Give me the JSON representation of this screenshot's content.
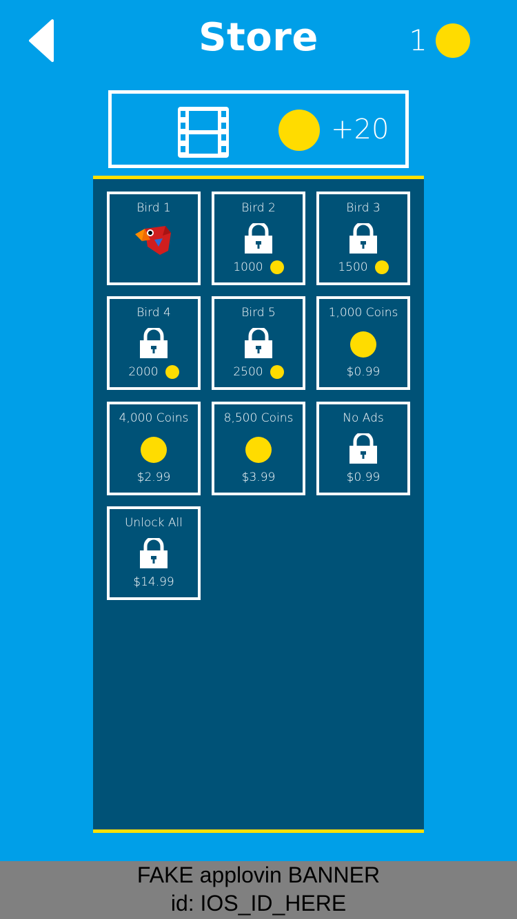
{
  "header": {
    "title": "Store",
    "back_icon": "back-chevron-icon",
    "coin_balance": "1"
  },
  "video_offer": {
    "icon": "film-icon",
    "reward": "+20"
  },
  "store_items": [
    {
      "label": "Bird 1",
      "icon": "bird-icon",
      "state": "owned"
    },
    {
      "label": "Bird 2",
      "icon": "lock-icon",
      "cost": "1000"
    },
    {
      "label": "Bird 3",
      "icon": "lock-icon",
      "cost": "1500"
    },
    {
      "label": "Bird 4",
      "icon": "lock-icon",
      "cost": "2000"
    },
    {
      "label": "Bird 5",
      "icon": "lock-icon",
      "cost": "2500"
    },
    {
      "label": "1,000 Coins",
      "icon": "coin-icon",
      "price": "$0.99"
    },
    {
      "label": "4,000 Coins",
      "icon": "coin-icon",
      "price": "$2.99"
    },
    {
      "label": "8,500 Coins",
      "icon": "coin-icon",
      "price": "$3.99"
    },
    {
      "label": "No Ads",
      "icon": "lock-icon",
      "price": "$0.99"
    },
    {
      "label": "Unlock All",
      "icon": "lock-icon",
      "price": "$14.99"
    }
  ],
  "banner": {
    "line1": "FAKE applovin BANNER",
    "line2": "id: IOS_ID_HERE"
  },
  "colors": {
    "background": "#009fe8",
    "panel": "#005277",
    "accent_yellow": "#ffe000",
    "coin": "#ffdc00",
    "banner": "#808080"
  }
}
